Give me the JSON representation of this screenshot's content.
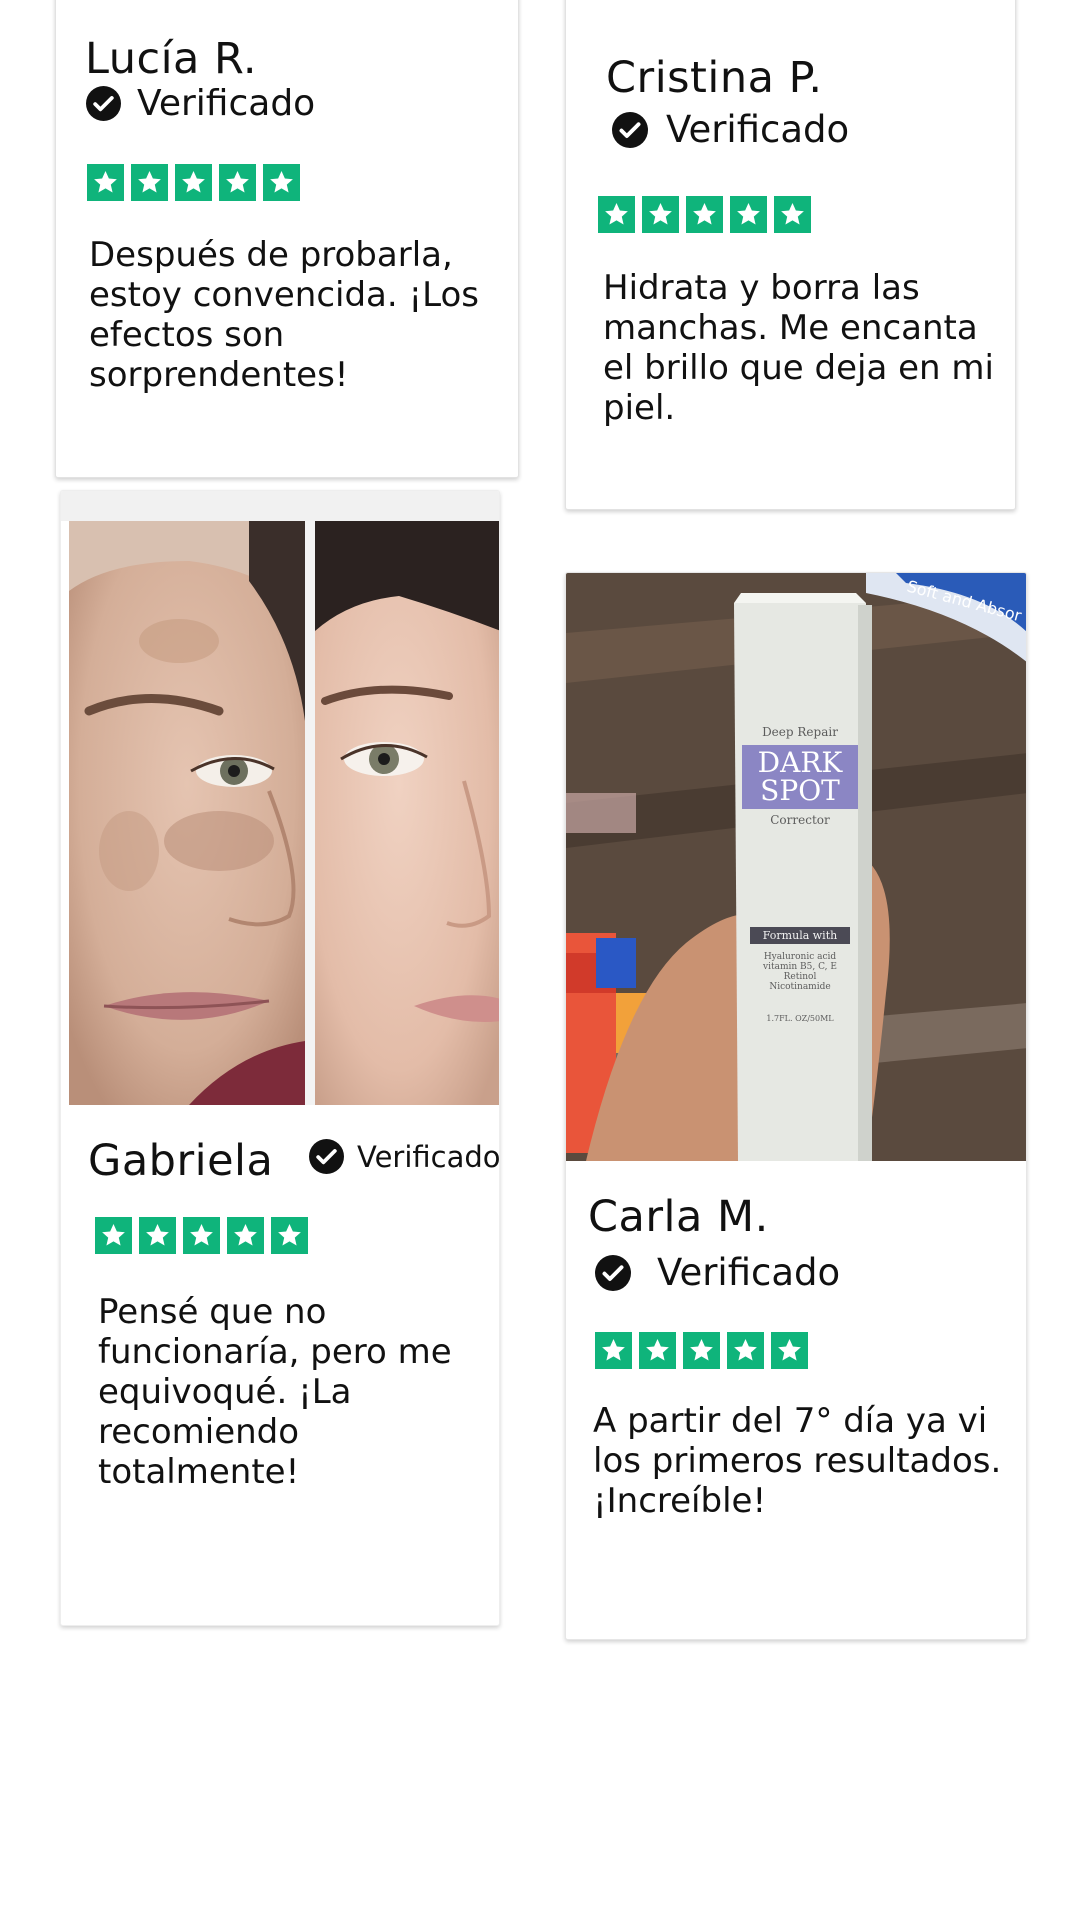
{
  "reviews": [
    {
      "name": "Lucía R.",
      "verified_label": "Verificado",
      "rating": 5,
      "text": "Después de probarla, estoy convencida. ¡Los efectos son sorprendentes!"
    },
    {
      "name": "Cristina P.",
      "verified_label": "Verificado",
      "rating": 5,
      "text": "Hidrata y borra las manchas. Me encanta el brillo que deja en mi piel."
    },
    {
      "name": "Gabriela",
      "verified_label": "Verificado",
      "rating": 5,
      "text": "Pensé que no funcionaría, pero me equivoqué. ¡La recomiendo totalmente!"
    },
    {
      "name": "Carla M.",
      "verified_label": "Verificado",
      "rating": 5,
      "text": "A partir del 7° día ya vi los primeros resultados. ¡Increíble!"
    }
  ],
  "product_box": {
    "line1": "Deep Repair",
    "line2": "DARK",
    "line3": "SPOT",
    "line4": "Corrector",
    "formula_label": "Formula with",
    "ingredients": [
      "Hyaluronic acid",
      "vitamin B5, C, E",
      "Retinol",
      "Nicotinamide"
    ],
    "volume": "1.7FL. OZ/50ML"
  },
  "background_package_text": "Soft and Absor",
  "colors": {
    "star_green": "#0fb47b",
    "text": "#111111",
    "check_fill": "#111111",
    "box_label_purple": "#8b86c4"
  },
  "icons": {
    "verified": "check-circle-icon",
    "star": "star-icon"
  }
}
